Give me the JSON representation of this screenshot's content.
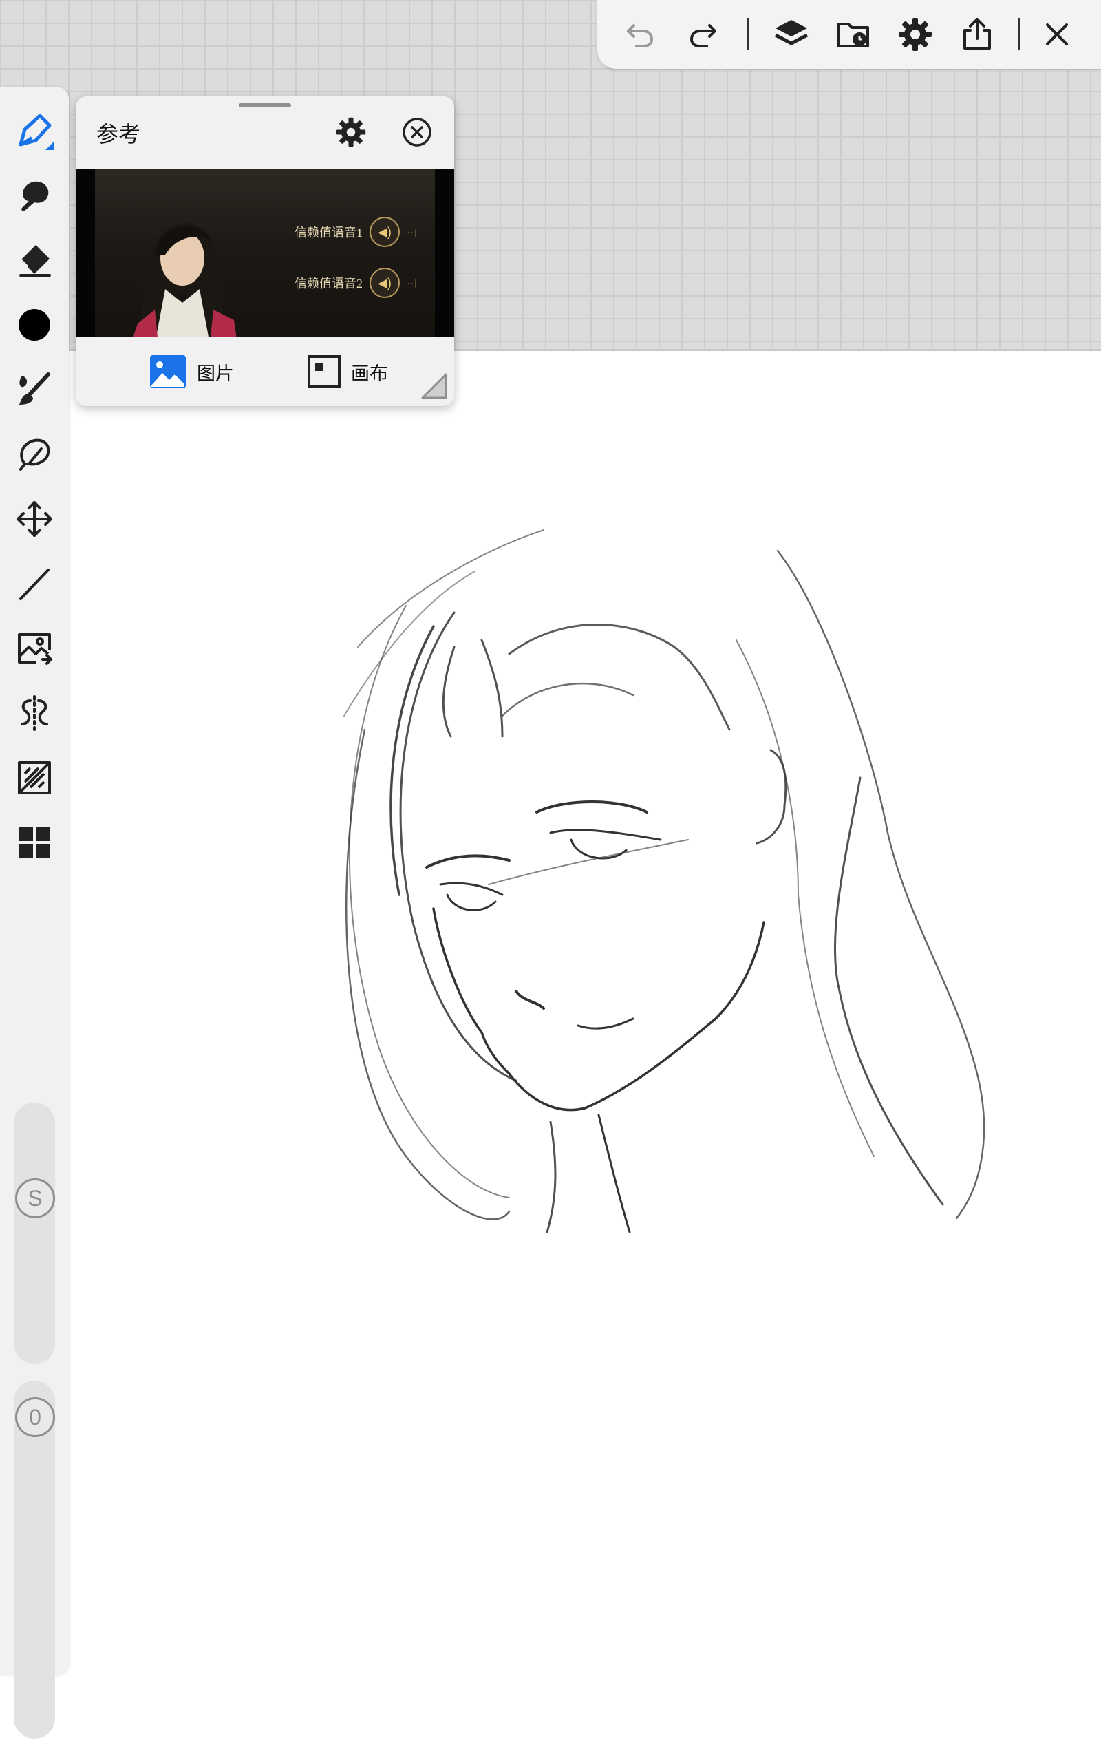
{
  "reference_panel": {
    "title": "参考",
    "image_voice_labels": [
      "信赖值语音1",
      "信赖值语音2"
    ],
    "tabs": [
      {
        "label": "图片",
        "icon": "image-icon",
        "active": true
      },
      {
        "label": "画布",
        "icon": "canvas-icon",
        "active": false
      }
    ]
  },
  "top_toolbar": {
    "icons": [
      "undo-icon",
      "redo-icon",
      "layers-icon",
      "gallery-folder-icon",
      "settings-icon",
      "share-icon",
      "close-icon"
    ]
  },
  "left_toolbar": {
    "tools": [
      "brush-icon",
      "smudge-icon",
      "eraser-icon",
      "color-icon",
      "brush-library-icon",
      "lasso-icon",
      "transform-icon",
      "line-icon",
      "reference-image-icon",
      "symmetry-icon",
      "adjust-icon",
      "more-icon"
    ],
    "size_slider_label": "S",
    "opacity_slider_label": "0"
  },
  "colors": {
    "accent": "#1a73e8",
    "current_color": "#000000",
    "toolbar_bg": "#f1f1f1"
  }
}
